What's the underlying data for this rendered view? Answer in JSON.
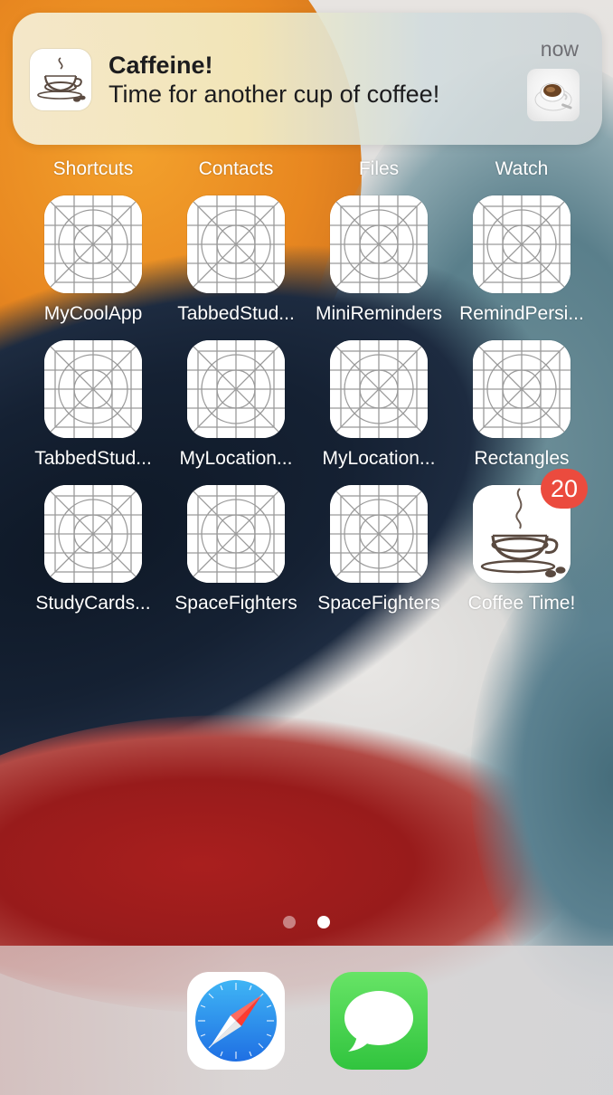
{
  "notification": {
    "app_icon": "coffee-cup-icon",
    "title": "Caffeine!",
    "body": "Time for another cup of coffee!",
    "time": "now",
    "thumbnail": "coffee-photo"
  },
  "top_row_labels": [
    "Shortcuts",
    "Contacts",
    "Files",
    "Watch"
  ],
  "apps": [
    {
      "label": "MyCoolApp",
      "icon": "placeholder-app-icon"
    },
    {
      "label": "TabbedStud...",
      "icon": "placeholder-app-icon"
    },
    {
      "label": "MiniReminders",
      "icon": "placeholder-app-icon"
    },
    {
      "label": "RemindPersi...",
      "icon": "placeholder-app-icon"
    },
    {
      "label": "TabbedStud...",
      "icon": "placeholder-app-icon"
    },
    {
      "label": "MyLocation...",
      "icon": "placeholder-app-icon"
    },
    {
      "label": "MyLocation...",
      "icon": "placeholder-app-icon"
    },
    {
      "label": "Rectangles",
      "icon": "placeholder-app-icon"
    },
    {
      "label": "StudyCards...",
      "icon": "placeholder-app-icon"
    },
    {
      "label": "SpaceFighters",
      "icon": "placeholder-app-icon"
    },
    {
      "label": "SpaceFighters",
      "icon": "placeholder-app-icon"
    },
    {
      "label": "Coffee Time!",
      "icon": "coffee-cup-icon",
      "badge": "20"
    }
  ],
  "page_indicator": {
    "pages": 2,
    "current": 2
  },
  "dock": [
    {
      "app": "Safari",
      "icon": "safari-compass-icon"
    },
    {
      "app": "Messages",
      "icon": "messages-bubble-icon"
    }
  ],
  "colors": {
    "badge": "#eb4b3e",
    "safari_blue": "#2f8cf0",
    "messages_green": "#4cd85e",
    "label_text": "#ffffff"
  }
}
